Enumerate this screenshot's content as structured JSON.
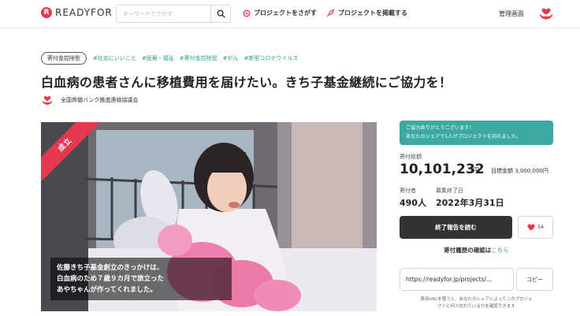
{
  "header": {
    "logo_mark": "R",
    "logo_text": "READYFOR",
    "search_placeholder": "キーワードでさがす",
    "nav_find": "プロジェクトをさがす",
    "nav_post": "プロジェクトを掲載する",
    "admin": "管理画面",
    "icons": [
      "search-icon",
      "target-icon",
      "rocket-icon",
      "hands-heart-icon"
    ]
  },
  "tags": {
    "category": "寄付金控除型",
    "items": [
      "#社会にいいこと",
      "#医療・福祉",
      "#寄付金控除型",
      "#がん",
      "#新型コロナウイルス"
    ]
  },
  "project": {
    "title": "白血病の患者さんに移植費用を届けたい。きち子基金継続にご協力を！",
    "org_name": "全国骨髄バンク推進連絡協議会"
  },
  "hero": {
    "ribbon": "成立",
    "caption_lines": [
      "佐藤きち子基金創立のきっかけは、",
      "白血病のため７歳９カ月で旅立った",
      "あやちゃんが作ってくれました。"
    ]
  },
  "sidebar": {
    "notice_lines": [
      "ご協力ありがとうございます！",
      "あなたのシェアで1人がプロジェクトを訪れました。"
    ],
    "total_label": "寄付総額",
    "total_value": "10,101,232",
    "total_unit": "円",
    "goal": "目標金額 3,000,000円",
    "donors_label": "寄付者",
    "donors_value": "490人",
    "end_label": "募集終了日",
    "end_value": "2022年3月31日",
    "report_button": "終了報告を読む",
    "like_count": "54",
    "history_text": "寄付履歴の確認は",
    "history_link": "こちら",
    "share_url": "https://readyfor.jp/projects/...",
    "copy_button": "コピー",
    "note_lines": [
      "専用URLを使うと、あなたのシェアによってこのプロジェ",
      "クトに何人訪れているかを確認できます"
    ]
  },
  "colors": {
    "brand_red": "#e8384f",
    "teal": "#3ba9a0",
    "dark_button": "#333333"
  }
}
